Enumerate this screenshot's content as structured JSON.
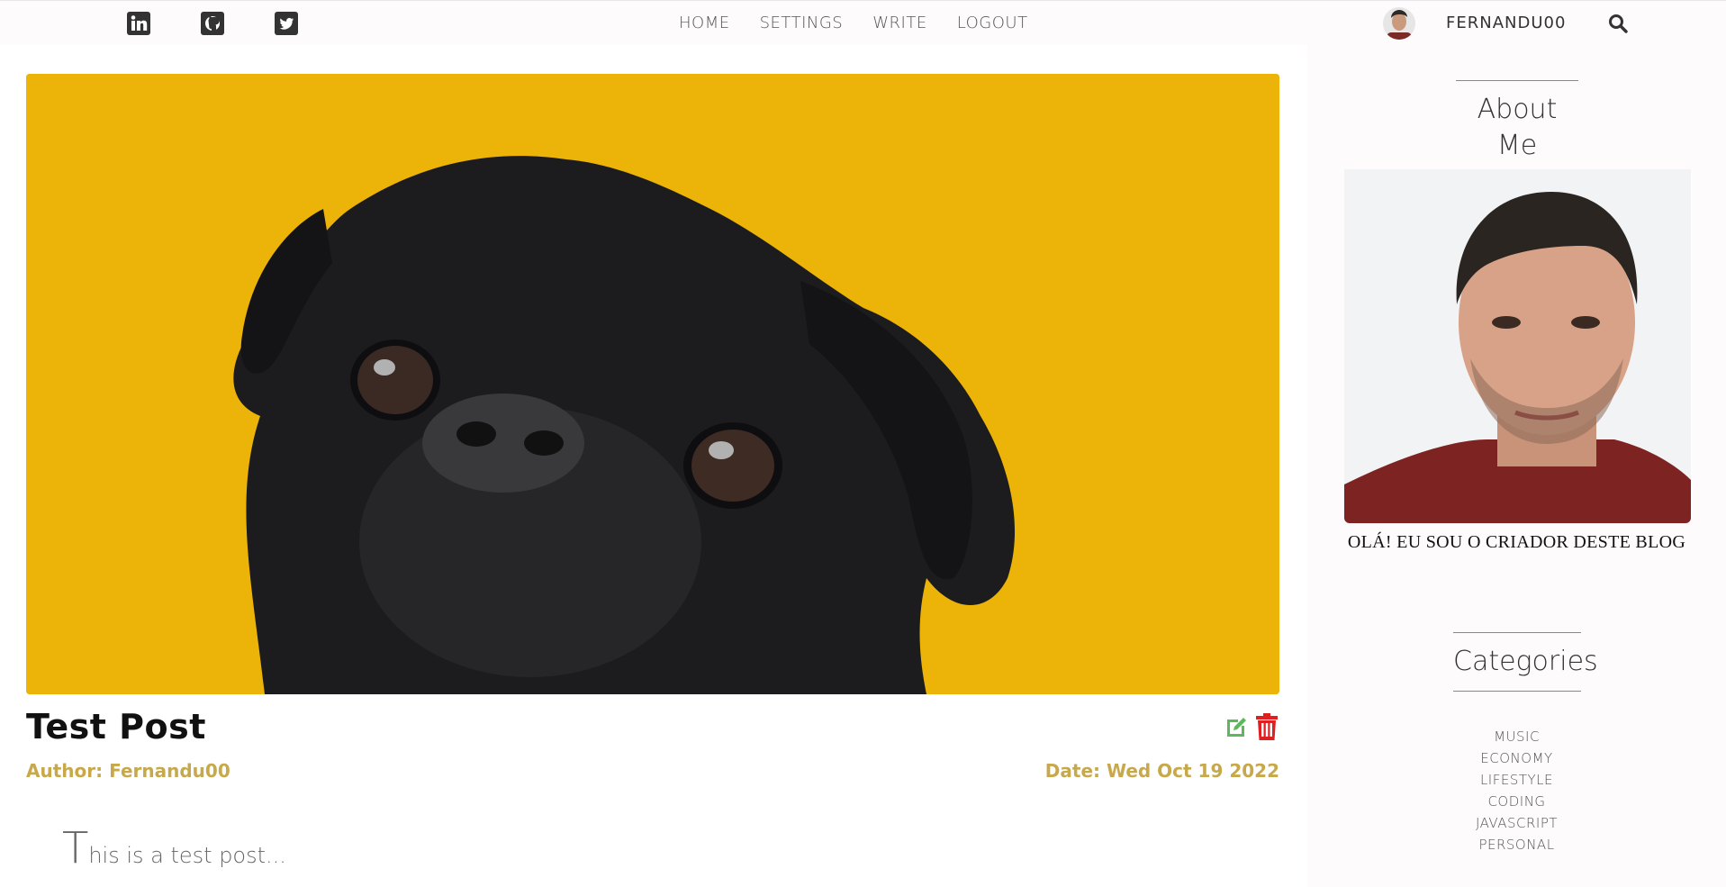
{
  "nav": {
    "social": [
      {
        "name": "linkedin"
      },
      {
        "name": "github"
      },
      {
        "name": "twitter"
      }
    ],
    "links": [
      "HOME",
      "SETTINGS",
      "WRITE",
      "LOGOUT"
    ],
    "username": "FERNANDU00"
  },
  "post": {
    "title": "Test Post",
    "author_label": "Author: ",
    "author": "Fernandu00",
    "date_label": "Date: ",
    "date": "Wed Oct 19 2022",
    "body_first_letter": "T",
    "body_rest": "his is a test post..."
  },
  "sidebar": {
    "about_title": "About Me",
    "about_text": "OLÁ! EU SOU O CRIADOR DESTE BLOG",
    "categories_title": "Categories",
    "categories": [
      "MUSIC",
      "ECONOMY",
      "LIFESTYLE",
      "CODING",
      "JAVASCRIPT",
      "PERSONAL"
    ]
  },
  "colors": {
    "accent_gold": "#c7a84a",
    "post_image_bg": "#ecb408",
    "edit_green": "#5cb85c",
    "delete_red": "#e02020"
  }
}
